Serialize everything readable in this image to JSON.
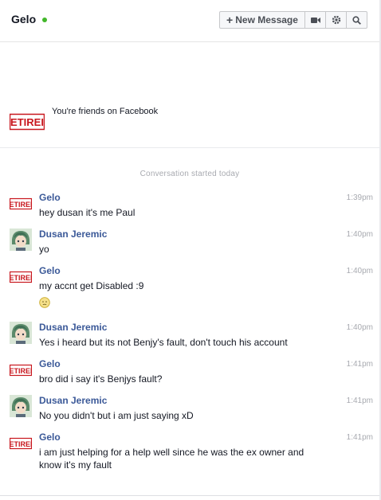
{
  "header": {
    "name": "Gelo",
    "new_message_label": "New Message"
  },
  "friends": {
    "text": "You're friends on Facebook"
  },
  "conversation": {
    "started_text": "Conversation started today"
  },
  "messages": [
    {
      "sender": "Gelo",
      "time": "1:39pm",
      "lines": [
        "hey dusan it's me Paul"
      ]
    },
    {
      "sender": "Dusan Jeremic",
      "time": "1:40pm",
      "lines": [
        "yo"
      ]
    },
    {
      "sender": "Gelo",
      "time": "1:40pm",
      "lines": [
        "my accnt get Disabled :9"
      ]
    },
    {
      "sender": "Dusan Jeremic",
      "time": "1:40pm",
      "lines": [
        "Yes i heard but its not Benjy's fault, don't touch his account"
      ]
    },
    {
      "sender": "Gelo",
      "time": "1:41pm",
      "lines": [
        "bro  did i say it's Benjys fault?"
      ]
    },
    {
      "sender": "Dusan Jeremic",
      "time": "1:41pm",
      "lines": [
        "No you didn't but i am just saying xD"
      ]
    },
    {
      "sender": "Gelo",
      "time": "1:41pm",
      "lines": [
        "i am just helping for a help well since he was the ex owner and know it's my fault"
      ]
    }
  ],
  "avatar_text": "ETIREI"
}
